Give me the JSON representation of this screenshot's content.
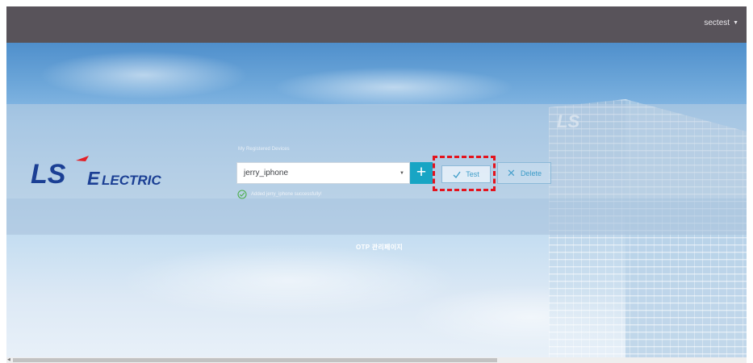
{
  "header": {
    "username": "sectest",
    "caret": "▼"
  },
  "brand": {
    "logo_text": "LS ELECTRIC",
    "logo_colors": {
      "primary": "#1b3f94",
      "accent": "#e31f26"
    }
  },
  "devices": {
    "label": "My Registered Devices",
    "selected": "jerry_iphone",
    "add_label": "+",
    "test_label": "Test",
    "delete_label": "Delete",
    "status_message": "Added jerry_iphone successfully!"
  },
  "footer": {
    "otp_label": "OTP 관리페이지"
  },
  "colors": {
    "topbar": "#58535a",
    "accent": "#18a5c4",
    "highlight": "#e4131d",
    "success": "#4cae4c"
  }
}
